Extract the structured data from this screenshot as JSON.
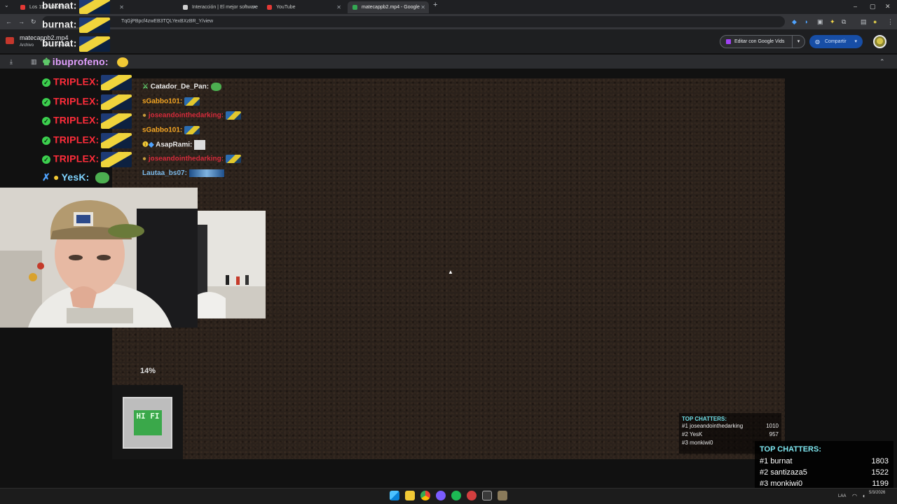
{
  "browser": {
    "tabs": [
      {
        "title": "Los 15 FRAMES",
        "icon_color": "#e53935"
      },
      {
        "title": "Interacción | El mejor software",
        "icon_color": "#cfcfcf"
      },
      {
        "title": "YouTube",
        "icon_color": "#e53935"
      },
      {
        "title": "matecappb2.mp4 - Google",
        "icon_color": "#34a853",
        "active": true
      }
    ],
    "new_tab": "+",
    "url": "TqGjPBpcf4zwEB3TQLYexBXzBR_Y/view",
    "window_controls": [
      "–",
      "▢",
      "✕"
    ]
  },
  "drive": {
    "file_title": "matecappb2.mp4",
    "menu": [
      "Archivo",
      "Ver",
      "Ayuda"
    ],
    "edit_button": "Editar con Google Vids",
    "share_button": "Compartir"
  },
  "stream": {
    "top_chat": [
      {
        "name": "burnat:"
      },
      {
        "name": "burnat:"
      },
      {
        "name": "burnat:"
      },
      {
        "name": "ibuprofeno:"
      }
    ],
    "left_chat": [
      {
        "name": "TRIPLEX:"
      },
      {
        "name": "TRIPLEX:"
      },
      {
        "name": "TRIPLEX:"
      },
      {
        "name": "TRIPLEX:"
      },
      {
        "name": "TRIPLEX:"
      },
      {
        "name": "YesK:"
      }
    ],
    "mid_chat": [
      {
        "name": "Catador_De_Pan:",
        "color": "#e8e8e8"
      },
      {
        "name": "sGabbo101:",
        "color": "#f5a623"
      },
      {
        "name": "joseandointhedarking:",
        "color": "#d62b3b"
      },
      {
        "name": "sGabbo101:",
        "color": "#f5a623"
      },
      {
        "name": "AsapRami:",
        "color": "#e8e8e8"
      },
      {
        "name": "joseandointhedarking:",
        "color": "#d62b3b"
      },
      {
        "name": "Lautaa_bs07:",
        "color": "#7ab8e8"
      }
    ],
    "progress_label": "14%",
    "logo_text": "HI FI",
    "top_chatters_small": {
      "title": "TOP CHATTERS:",
      "rows": [
        {
          "rank": "#1",
          "name": "joseandointhedarking",
          "count": "1010"
        },
        {
          "rank": "#2",
          "name": "YesK",
          "count": "957"
        },
        {
          "rank": "#3",
          "name": "monkiwi0",
          "count": ""
        }
      ]
    },
    "top_chatters_big": {
      "title": "TOP CHATTERS:",
      "rows": [
        {
          "rank": "#1",
          "name": "burnat",
          "count": "1803"
        },
        {
          "rank": "#2",
          "name": "santizaza5",
          "count": "1522"
        },
        {
          "rank": "#3",
          "name": "monkiwi0",
          "count": "1199"
        }
      ]
    }
  },
  "taskbar": {
    "lang": "LAA",
    "date": "5/3/2026"
  }
}
